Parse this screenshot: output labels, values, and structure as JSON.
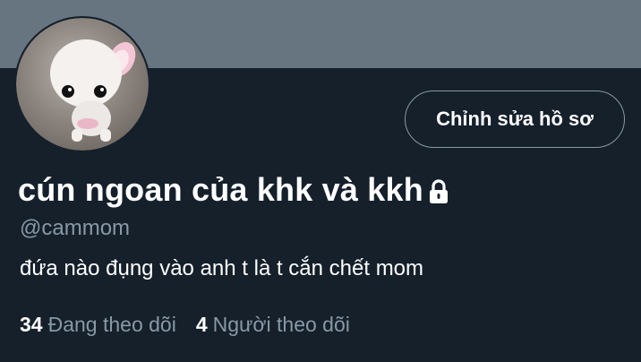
{
  "profile": {
    "display_name": "cún ngoan của khk và kkh",
    "handle": "@cammom",
    "bio": "đứa nào đụng vào anh t là t cắn chết mom",
    "protected_icon": "lock-icon"
  },
  "actions": {
    "edit_profile_label": "Chỉnh sửa hồ sơ"
  },
  "stats": {
    "following_count": "34",
    "following_label": "Đang theo dõi",
    "followers_count": "4",
    "followers_label": "Người theo dõi"
  },
  "colors": {
    "background": "#15202b",
    "banner": "#66757f",
    "secondary_text": "#8899a6",
    "primary_text": "#ffffff"
  }
}
